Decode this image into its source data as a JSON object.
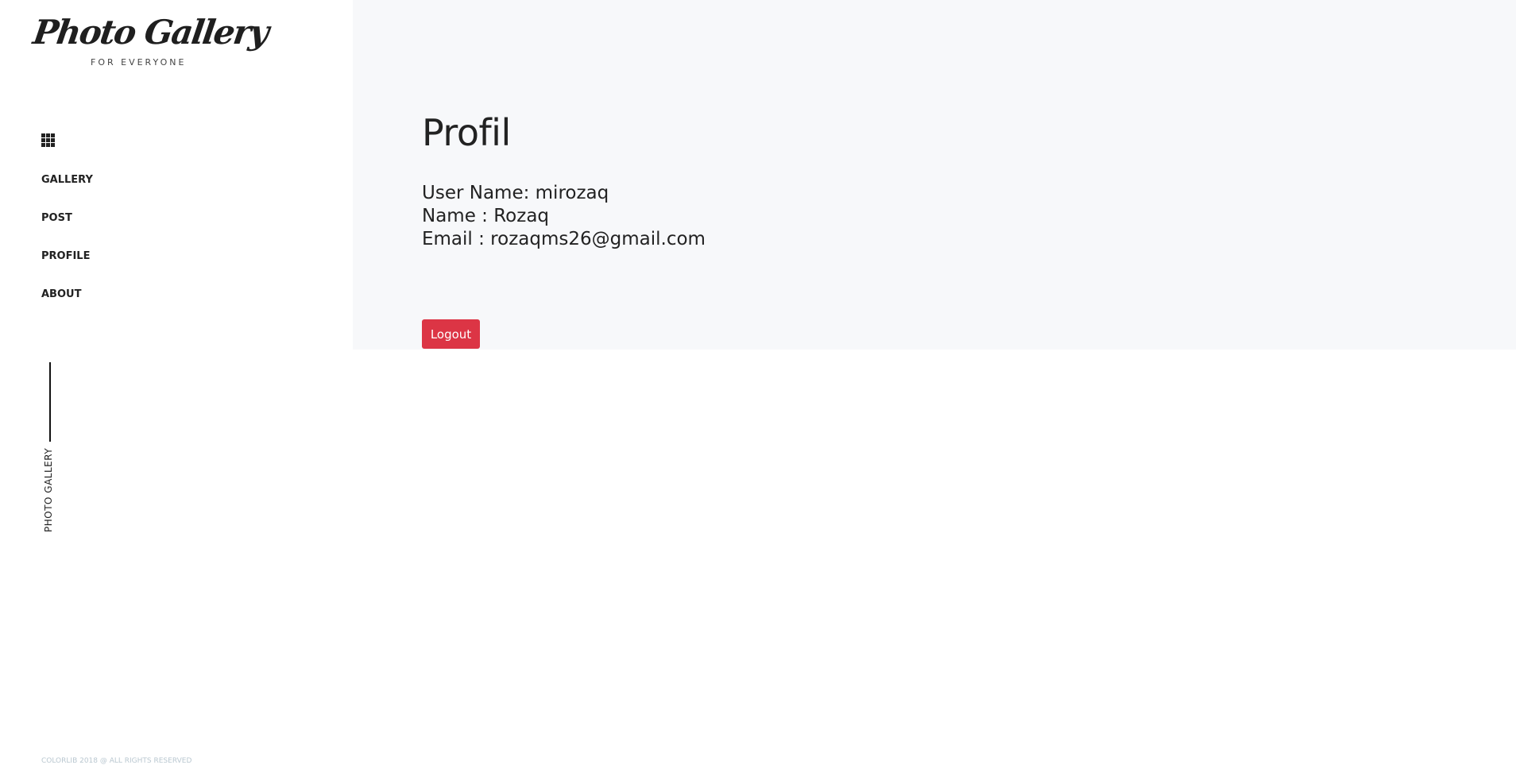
{
  "logo": {
    "title": "Photo Gallery",
    "subtitle": "FOR EVERYONE"
  },
  "nav": {
    "menu_icon": "grid-icon",
    "items": [
      {
        "label": "GALLERY"
      },
      {
        "label": "POST"
      },
      {
        "label": "PROFILE"
      },
      {
        "label": "ABOUT"
      }
    ]
  },
  "sidebar": {
    "vertical_label": "PHOTO GALLERY",
    "footer": "COLORLIB 2018 @ ALL RIGHTS RESERVED"
  },
  "profile": {
    "title": "Profil",
    "username_line": "User Name: mirozaq",
    "name_line": "Name : Rozaq",
    "email_line": "Email : rozaqms26@gmail.com",
    "logout_label": "Logout"
  },
  "colors": {
    "logout_button": "#dc3545",
    "main_panel_bg": "#f7f8fa",
    "footer_text": "#b9c7d0"
  }
}
